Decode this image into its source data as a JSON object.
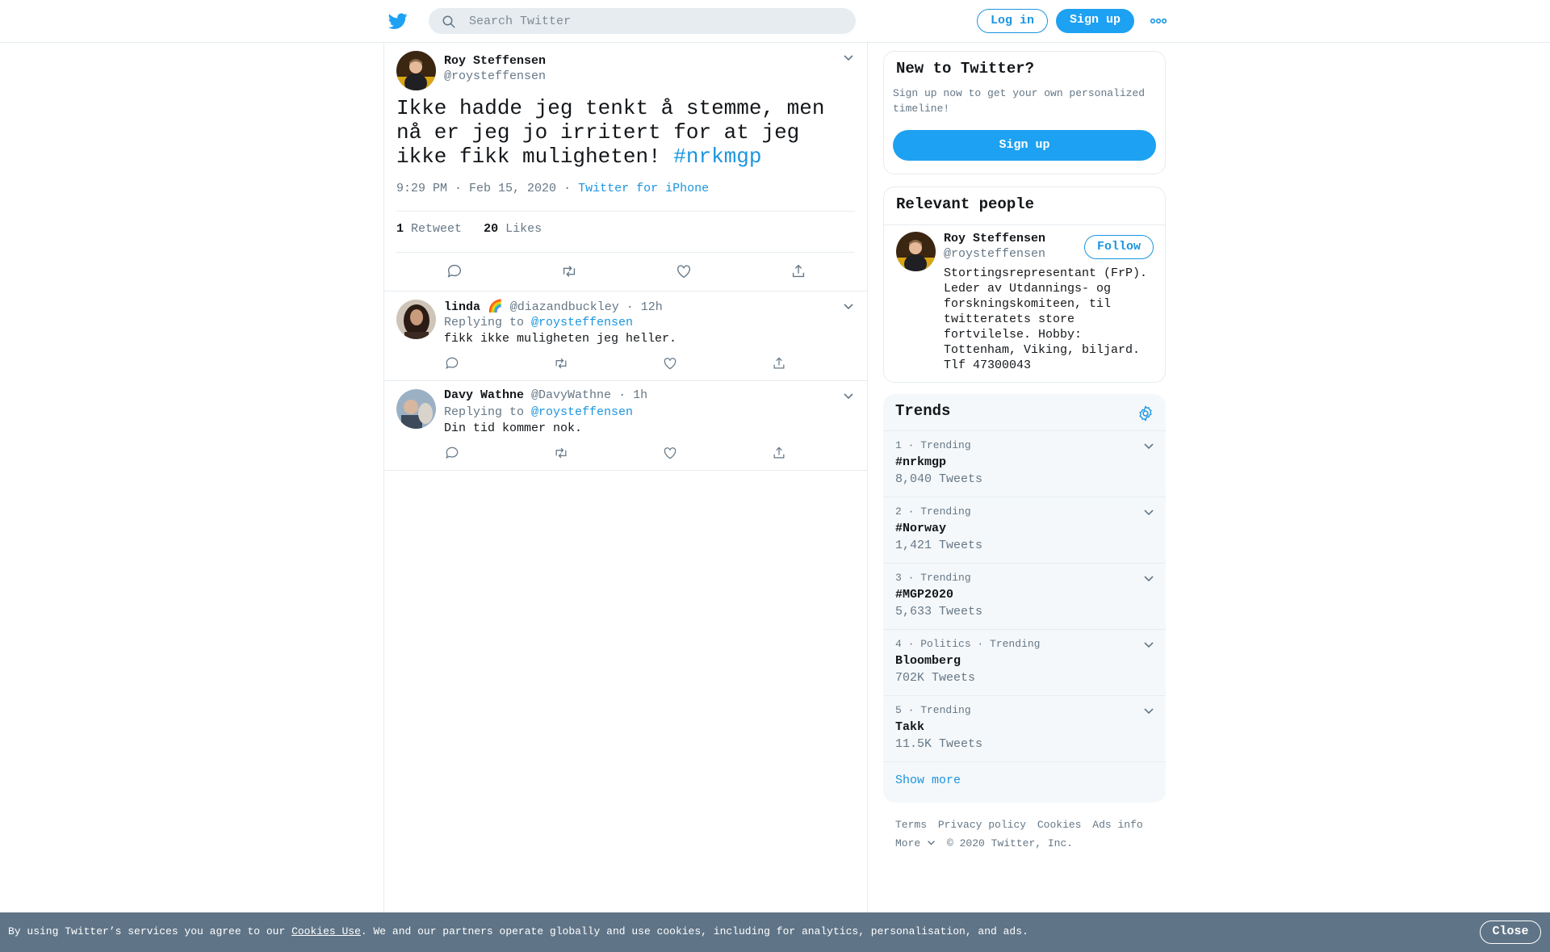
{
  "header": {
    "search_placeholder": "Search Twitter",
    "login_label": "Log in",
    "signup_label": "Sign up",
    "more_icon": "more-horizontal-icon"
  },
  "main_tweet": {
    "name": "Roy Steffensen",
    "handle": "@roysteffensen",
    "text": "Ikke hadde jeg tenkt å stemme, men nå er jeg jo irritert for at jeg ikke fikk muligheten! ",
    "hashtag": "#nrkmgp",
    "time": "9:29 PM · Feb 15, 2020",
    "separator": "·",
    "source": "Twitter for iPhone",
    "retweets": "1",
    "retweets_label": "Retweet",
    "likes": "20",
    "likes_label": "Likes"
  },
  "replies": [
    {
      "name": "linda 🌈",
      "handle": "@diazandbuckley",
      "time": "· 12h",
      "replying_prefix": "Replying to ",
      "replying_to": "@roysteffensen",
      "text": "fikk ikke muligheten jeg heller."
    },
    {
      "name": "Davy Wathne",
      "handle": "@DavyWathne",
      "time": "· 1h",
      "replying_prefix": "Replying to ",
      "replying_to": "@roysteffensen",
      "text": "Din tid kommer nok."
    }
  ],
  "new_to_twitter": {
    "title": "New to Twitter?",
    "subtitle": "Sign up now to get your own personalized timeline!",
    "button": "Sign up"
  },
  "relevant_people": {
    "title": "Relevant people",
    "name": "Roy Steffensen",
    "handle": "@roysteffensen",
    "follow_label": "Follow",
    "bio": "Stortingsrepresentant (FrP). Leder av Utdannings- og forskningskomiteen, til twitteratets store fortvilelse. Hobby: Tottenham, Viking, biljard. Tlf 47300043"
  },
  "trends": {
    "title": "Trends",
    "items": [
      {
        "meta": "1 · Trending",
        "name": "#nrkmgp",
        "count": "8,040 Tweets"
      },
      {
        "meta": "2 · Trending",
        "name": "#Norway",
        "count": "1,421 Tweets"
      },
      {
        "meta": "3 · Trending",
        "name": "#MGP2020",
        "count": "5,633 Tweets"
      },
      {
        "meta": "4 · Politics · Trending",
        "name": "Bloomberg",
        "count": "702K Tweets"
      },
      {
        "meta": "5 · Trending",
        "name": "Takk",
        "count": "11.5K Tweets"
      }
    ],
    "show_more": "Show more"
  },
  "footer": {
    "links": [
      "Terms",
      "Privacy policy",
      "Cookies",
      "Ads info"
    ],
    "more": "More",
    "copyright": "© 2020 Twitter, Inc."
  },
  "cookie_bar": {
    "prefix": "By using Twitter’s services you agree to our ",
    "link": "Cookies Use",
    "suffix": ". We and our partners operate globally and use cookies, including for analytics, personalisation, and ads.",
    "close": "Close"
  },
  "colors": {
    "accent": "#1da1f2",
    "link": "#1b95e0",
    "cookie_bar": "#5f7487"
  }
}
